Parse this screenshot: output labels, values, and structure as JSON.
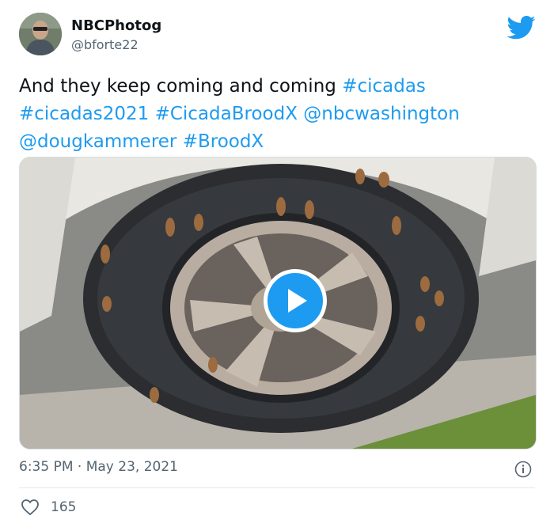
{
  "tweet": {
    "display_name": "NBCPhotog",
    "handle": "@bforte22",
    "text_plain": "And they keep coming and coming ",
    "hashtags": {
      "cicadas": "#cicadas",
      "cicadas2021": "#cicadas2021",
      "broodx_cicada": "#CicadaBroodX",
      "mention_nbc": "@nbcwashington",
      "mention_doug": "@dougkammerer",
      "broodx": "#BroodX"
    },
    "timestamp": "6:35 PM · May 23, 2021",
    "likes": "165"
  },
  "icons": {
    "brand": "twitter-bird-icon",
    "play": "play-icon",
    "info": "info-icon",
    "like": "heart-icon"
  },
  "colors": {
    "accent": "#1d9bf0",
    "secondary_text": "#536471",
    "primary_text": "#0f1419"
  }
}
